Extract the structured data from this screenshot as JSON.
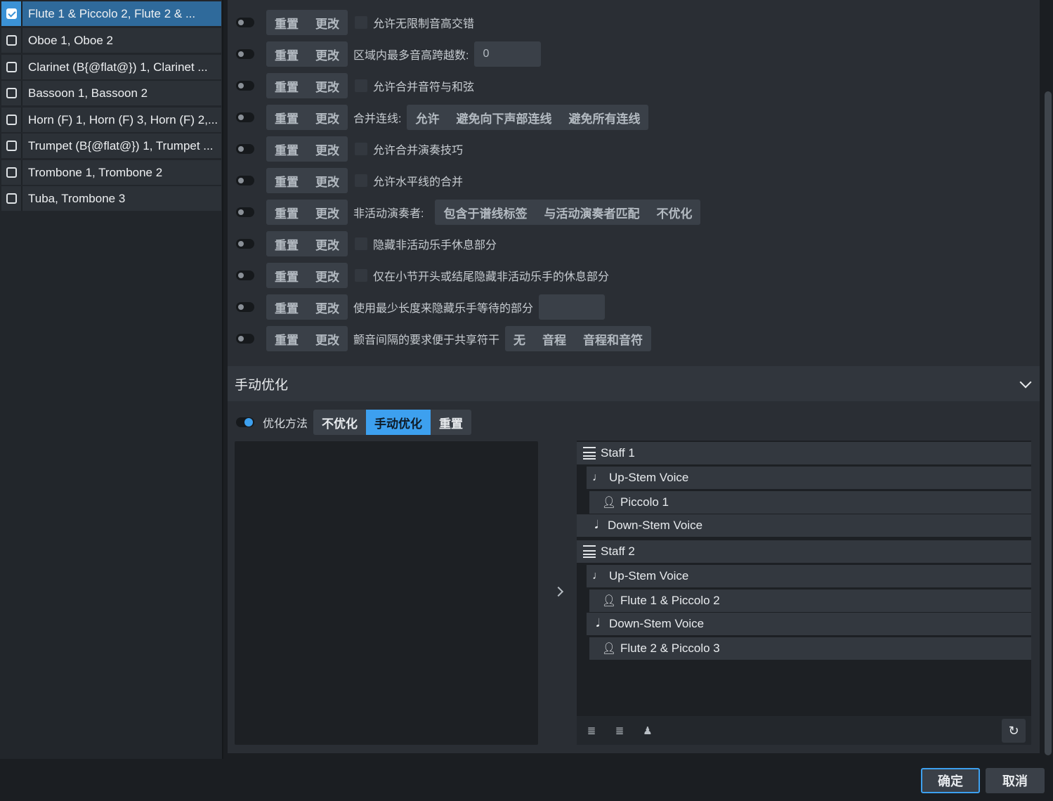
{
  "sidebar": {
    "items": [
      {
        "label": "Flute 1 & Piccolo 2, Flute 2 & ...",
        "checked": true
      },
      {
        "label": "Oboe 1, Oboe 2",
        "checked": false
      },
      {
        "label": "Clarinet (B{@flat@}) 1, Clarinet ...",
        "checked": false
      },
      {
        "label": "Bassoon 1, Bassoon 2",
        "checked": false
      },
      {
        "label": "Horn (F) 1, Horn (F) 3, Horn (F) 2,...",
        "checked": false
      },
      {
        "label": "Trumpet (B{@flat@}) 1, Trumpet ...",
        "checked": false
      },
      {
        "label": "Trombone 1, Trombone 2",
        "checked": false
      },
      {
        "label": "Tuba, Trombone 3",
        "checked": false
      }
    ]
  },
  "common": {
    "reset": "重置",
    "change": "更改"
  },
  "options": {
    "r1": "允许无限制音高交错",
    "r2_label": "区域内最多音高跨越数:",
    "r2_value": "0",
    "r3": "允许合并音符与和弦",
    "r4_label": "合并连线:",
    "r4_opts": [
      "允许",
      "避免向下声部连线",
      "避免所有连线"
    ],
    "r5": "允许合并演奏技巧",
    "r6": "允许水平线的合并",
    "r7_label": "非活动演奏者:",
    "r7_opts": [
      "包含于谱线标签",
      "与活动演奏者匹配",
      "不优化"
    ],
    "r8": "隐藏非活动乐手休息部分",
    "r9": "仅在小节开头或结尾隐藏非活动乐手的休息部分",
    "r10": "使用最少长度来隐藏乐手等待的部分",
    "r11_label": "颤音间隔的要求便于共享符干",
    "r11_opts": [
      "无",
      "音程",
      "音程和音符"
    ]
  },
  "manual": {
    "title": "手动优化",
    "method_label": "优化方法",
    "method_opts": [
      "不优化",
      "手动优化",
      "重置"
    ],
    "active_method": "手动优化"
  },
  "tree": {
    "staff1": "Staff 1",
    "staff1_up": "Up-Stem Voice",
    "staff1_up_player": "Piccolo 1",
    "staff1_down": "Down-Stem Voice",
    "staff2": "Staff 2",
    "staff2_up": "Up-Stem Voice",
    "staff2_up_player": "Flute 1 & Piccolo 2",
    "staff2_down": "Down-Stem Voice",
    "staff2_down_player": "Flute 2 & Piccolo 3"
  },
  "footer": {
    "ok": "确定",
    "cancel": "取消"
  }
}
